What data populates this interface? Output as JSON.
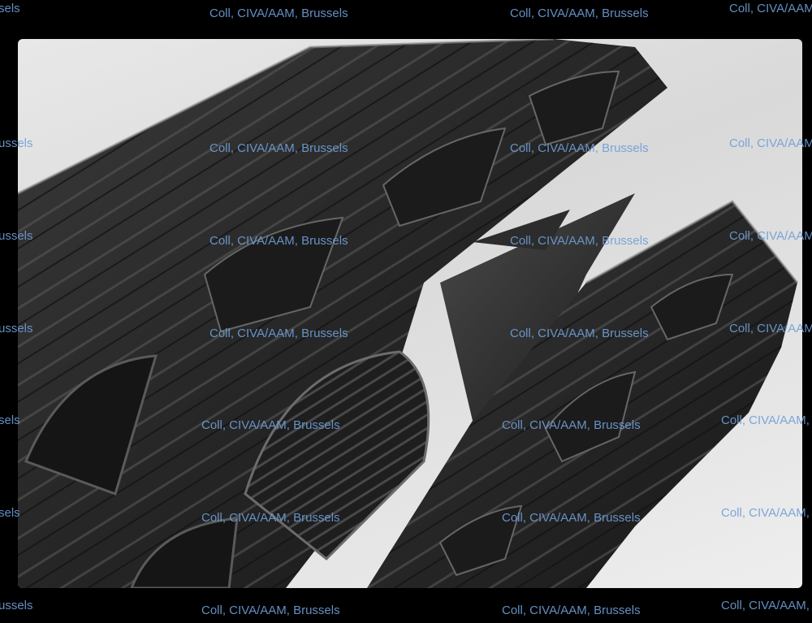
{
  "image": {
    "subject": "gothic-cathedral-facade-bw-photo"
  },
  "watermark": {
    "text": "Coll, CIVA/AAM, Brussels",
    "fragments": {
      "left_edge": "ussels",
      "left_edge_short": "sels",
      "right_edge_cut": "Coll, CIVA/AAM,"
    },
    "color": "#6f9fd8"
  }
}
